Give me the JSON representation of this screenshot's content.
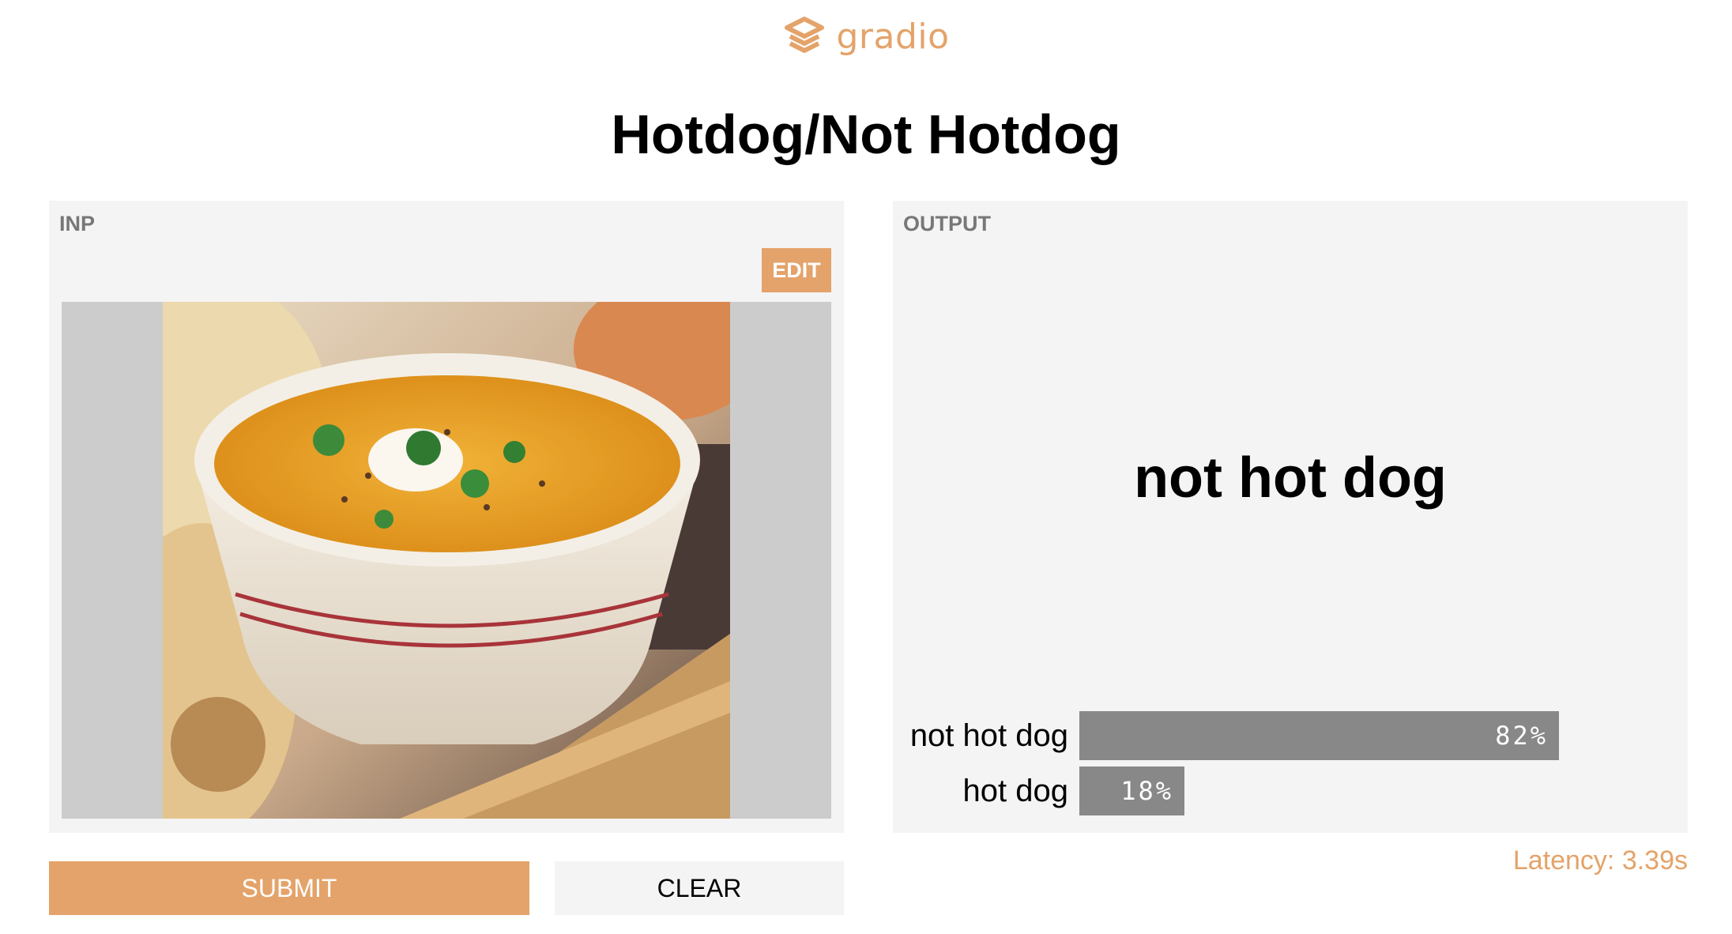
{
  "header": {
    "logo_text": "gradio",
    "logo_icon": "gradio-logo-icon"
  },
  "title": "Hotdog/Not Hotdog",
  "input_panel": {
    "label": "INP",
    "edit_label": "EDIT",
    "image": "soup-bowl-photo"
  },
  "output_panel": {
    "label": "OUTPUT",
    "prediction": "not hot dog",
    "confidences": [
      {
        "label": "not hot dog",
        "value": 0.82,
        "text": "82%"
      },
      {
        "label": "hot dog",
        "value": 0.18,
        "text": "18%"
      }
    ]
  },
  "actions": {
    "submit_label": "SUBMIT",
    "clear_label": "CLEAR"
  },
  "latency": "Latency: 3.39s",
  "colors": {
    "accent": "#e4a36a",
    "panel_bg": "#f4f4f4",
    "bar": "#888888"
  }
}
